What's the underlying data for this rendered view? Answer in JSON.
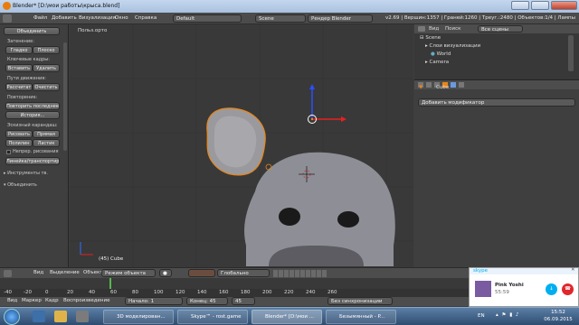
{
  "titlebar": {
    "title": "Blender* [D:\\мои работы\\крыса.blend]"
  },
  "menu": [
    "Файл",
    "Добавить",
    "Визуализация",
    "Окно",
    "Справка"
  ],
  "layout": "Default",
  "scene": "Scene",
  "engine": "Рендер Blender",
  "stats": "v2.69 | Вершин:1357 | Граней:1260 | Треуг.:2480 | Объектов:1/4 | Лампы",
  "tools": {
    "top_btn": "Объединить",
    "shading_label": "Затенение:",
    "smooth": "Гладко",
    "flat": "Плоско",
    "keyframes_label": "Ключевые кадры:",
    "insert": "Вставить",
    "delete": "Удалить",
    "motion_label": "Пути движения:",
    "calculate": "Рассчитат",
    "clear": "Очистить",
    "repeat_label": "Повторение:",
    "repeat_last": "Повторить последнее",
    "history": "История...",
    "gp_label": "Эскизный карандаш:",
    "draw": "Рисовать",
    "line": "Прямая",
    "poly": "Полилин",
    "erase": "Ластик",
    "cont_draw": "Непрер. рисования",
    "ruler": "Линейка/транспортир",
    "tool_section": "Инструменты тв.",
    "merge_section": "Объединить"
  },
  "viewport": {
    "label": "Польз.орто",
    "object_label": "(45) Cube"
  },
  "outliner": {
    "view": "Вид",
    "search": "Поиск",
    "scenes": "Все сцены",
    "items": [
      "Scene",
      "Слои визуализации",
      "World",
      "Camera"
    ]
  },
  "props": {
    "object": "Cube",
    "add_modifier": "Добавить модификатор"
  },
  "vphead": {
    "view": "Вид",
    "select": "Выделение",
    "object": "Объект",
    "mode": "Режим объекта",
    "pivot": "Глобально"
  },
  "timeline": {
    "ticks": [
      "-40",
      "-20",
      "0",
      "20",
      "40",
      "60",
      "80",
      "100",
      "120",
      "140",
      "160",
      "180",
      "200",
      "220",
      "240",
      "260"
    ]
  },
  "tlhead": {
    "view": "Вид",
    "marker": "Маркер",
    "frame": "Кадр",
    "playback": "Воспроизведение",
    "start": "Начало: 1",
    "end": "Конец: 45",
    "current": "45",
    "sync": "Без синхронизации"
  },
  "taskbar": {
    "items": [
      "3D моделирован...",
      "Skype™ - rost.game",
      "Blender* [D:\\мои ...",
      "Безымянный - P..."
    ],
    "lang": "EN",
    "time": "15:52",
    "date": "06.09.2015"
  },
  "skype": {
    "brand": "skype",
    "name": "Pink Yoshi",
    "time": "55:59"
  }
}
